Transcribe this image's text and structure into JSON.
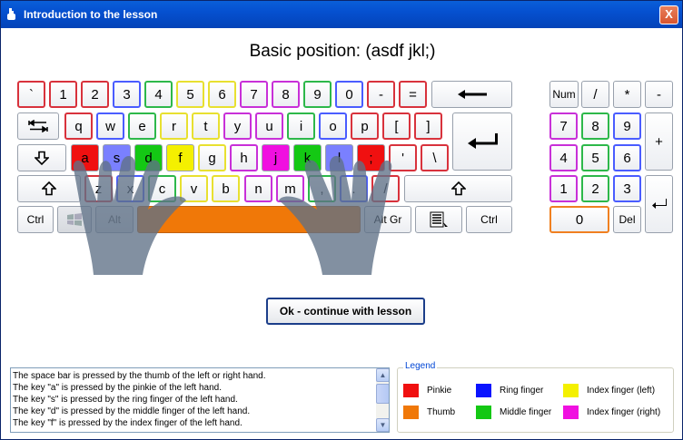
{
  "window": {
    "title": "Introduction to the lesson",
    "close_label": "X"
  },
  "heading": "Basic position: (asdf jkl;)",
  "keyboard": {
    "row1": [
      "`",
      "1",
      "2",
      "3",
      "4",
      "5",
      "6",
      "7",
      "8",
      "9",
      "0",
      "-",
      "="
    ],
    "row2": [
      "q",
      "w",
      "e",
      "r",
      "t",
      "y",
      "u",
      "i",
      "o",
      "p",
      "[",
      "]"
    ],
    "row3": [
      "a",
      "s",
      "d",
      "f",
      "g",
      "h",
      "j",
      "k",
      "l",
      ";",
      "'",
      "\\"
    ],
    "row4": [
      "z",
      "x",
      "c",
      "v",
      "b",
      "n",
      "m",
      ",",
      ".",
      "/"
    ],
    "ctrl_left": "Ctrl",
    "alt": "Alt",
    "alt_gr": "Alt Gr",
    "ctrl_right": "Ctrl"
  },
  "numpad": {
    "row1": [
      "Num",
      "/",
      "*",
      "-"
    ],
    "row2": [
      "7",
      "8",
      "9"
    ],
    "plus": "+",
    "row3": [
      "4",
      "5",
      "6"
    ],
    "row4": [
      "1",
      "2",
      "3"
    ],
    "row5": [
      "0",
      "Del"
    ]
  },
  "ok_button": "Ok - continue with lesson",
  "info_lines": [
    "The space bar is pressed by the thumb of the left or right hand.",
    "The key \"a\" is pressed by the pinkie of the left hand.",
    "The key \"s\" is pressed by the ring finger of the left hand.",
    "The key \"d\" is pressed by the middle finger of the left hand.",
    "The key \"f\" is pressed by the index finger of the left hand."
  ],
  "legend": {
    "title": "Legend",
    "items": [
      {
        "label": "Pinkie",
        "color": "#f01010"
      },
      {
        "label": "Ring finger",
        "color": "#0a14ff"
      },
      {
        "label": "Index finger (left)",
        "color": "#f4f000"
      },
      {
        "label": "Thumb",
        "color": "#f07808"
      },
      {
        "label": "Middle finger",
        "color": "#14c814"
      },
      {
        "label": "Index finger (right)",
        "color": "#f010e0"
      }
    ]
  }
}
